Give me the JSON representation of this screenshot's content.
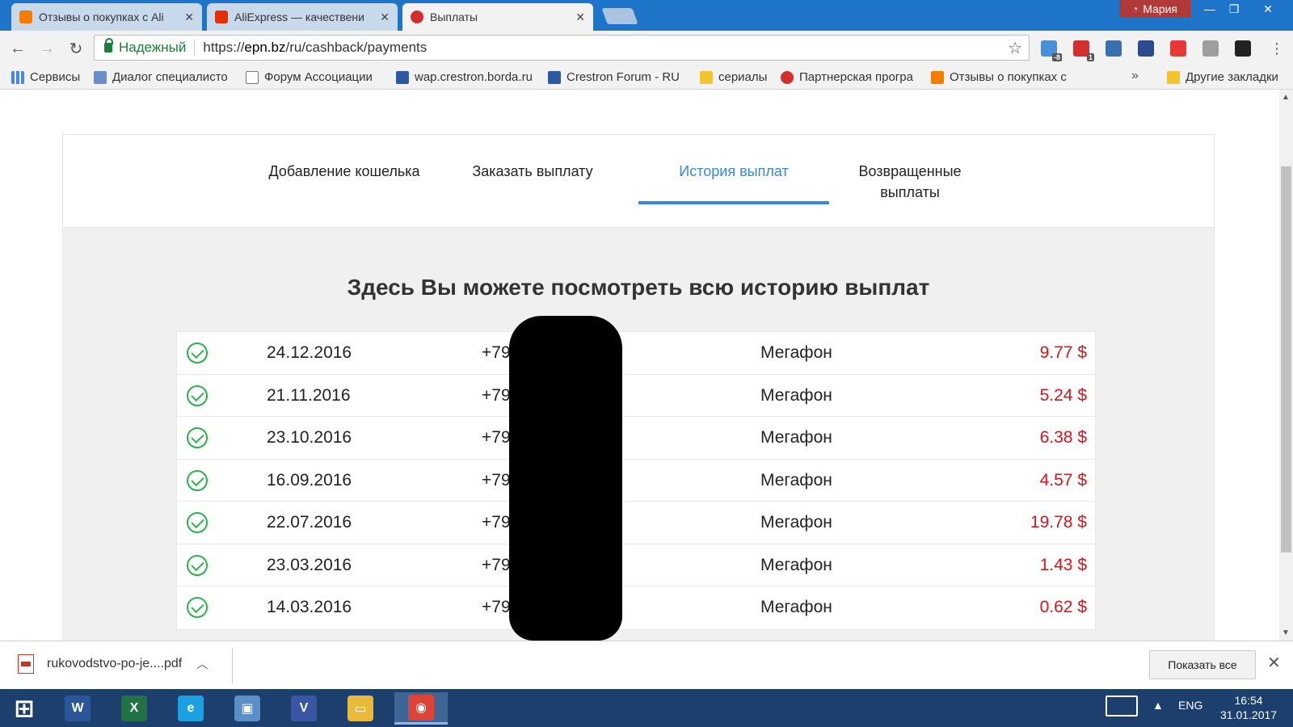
{
  "browser": {
    "tabs": [
      {
        "title": "Отзывы о покупках с Ali",
        "favicon_color": "#f57c00"
      },
      {
        "title": "AliExpress — качествени",
        "favicon_color": "#e62e04"
      },
      {
        "title": "Выплаты",
        "favicon_color": "#d32f2f"
      }
    ],
    "close_glyph": "✕",
    "profile_name": "Мария",
    "window_controls": {
      "minimize": "—",
      "restore": "❐",
      "close": "✕"
    },
    "address": {
      "secure_label": "Надежный",
      "scheme": "https://",
      "host": "epn.bz",
      "path": "/ru/cashback/payments"
    },
    "extensions": [
      {
        "name": "weather-icon",
        "badge": "-8",
        "color": "#4a90d9"
      },
      {
        "name": "adblock-icon",
        "badge": "1",
        "color": "#d32f2f"
      },
      {
        "name": "download-icon",
        "badge": "",
        "color": "#3a6fb0"
      },
      {
        "name": "chart-icon",
        "badge": "",
        "color": "#2c4b8f"
      },
      {
        "name": "epn-icon",
        "badge": "",
        "color": "#e53935"
      },
      {
        "name": "cloud-icon",
        "badge": "",
        "color": "#9e9e9e"
      },
      {
        "name": "panel-icon",
        "badge": "",
        "color": "#222222"
      }
    ],
    "bookmarks": [
      {
        "label": "Сервисы",
        "color": "#4285f4"
      },
      {
        "label": "Диалог специалисто",
        "color": "#6a8fc8"
      },
      {
        "label": "Форум Ассоциации",
        "color": "#777777"
      },
      {
        "label": "wap.crestron.borda.ru",
        "color": "#2c5aa0"
      },
      {
        "label": "Crestron Forum - RU",
        "color": "#2c5aa0"
      },
      {
        "label": "сериалы",
        "color": "#f4c430"
      },
      {
        "label": "Партнерская програ",
        "color": "#d32f2f"
      },
      {
        "label": "Отзывы о покупках с",
        "color": "#f57c00"
      }
    ],
    "bookmarks_more": "»",
    "other_bookmarks": "Другие закладки"
  },
  "page": {
    "tabs": [
      {
        "label": "Добавление кошелька"
      },
      {
        "label": "Заказать выплату"
      },
      {
        "label": "История выплат"
      },
      {
        "label": "Возвращенные выплаты"
      }
    ],
    "heading": "Здесь Вы можете посмотреть всю историю выплат",
    "payments": [
      {
        "date": "24.12.2016",
        "phone": "+79",
        "operator": "Мегафон",
        "amount": "9.77 $"
      },
      {
        "date": "21.11.2016",
        "phone": "+79",
        "operator": "Мегафон",
        "amount": "5.24 $"
      },
      {
        "date": "23.10.2016",
        "phone": "+79",
        "operator": "Мегафон",
        "amount": "6.38 $"
      },
      {
        "date": "16.09.2016",
        "phone": "+792",
        "operator": "Мегафон",
        "amount": "4.57 $"
      },
      {
        "date": "22.07.2016",
        "phone": "+792",
        "operator": "Мегафон",
        "amount": "19.78 $"
      },
      {
        "date": "23.03.2016",
        "phone": "+792",
        "operator": "Мегафон",
        "amount": "1.43 $"
      },
      {
        "date": "14.03.2016",
        "phone": "+792",
        "operator": "Мегафон",
        "amount": "0.62 $"
      }
    ]
  },
  "downloads": {
    "file": "rukovodstvo-po-je....pdf",
    "show_all": "Показать все",
    "close_glyph": "✕"
  },
  "taskbar": {
    "apps": [
      {
        "name": "start-icon",
        "glyph": "⊞",
        "color": "#1c3f6e"
      },
      {
        "name": "word-icon",
        "glyph": "W",
        "color": "#2b579a"
      },
      {
        "name": "excel-icon",
        "glyph": "X",
        "color": "#217346"
      },
      {
        "name": "ie-icon",
        "glyph": "e",
        "color": "#1ba1e2"
      },
      {
        "name": "control-panel-icon",
        "glyph": "▣",
        "color": "#5a8fc7"
      },
      {
        "name": "visio-icon",
        "glyph": "V",
        "color": "#3955a3"
      },
      {
        "name": "explorer-icon",
        "glyph": "▭",
        "color": "#e8b93a"
      },
      {
        "name": "chrome-icon",
        "glyph": "◉",
        "color": "#db4437"
      }
    ],
    "language": "ENG",
    "time": "16:54",
    "date": "31.01.2017"
  },
  "colors": {
    "accent": "#3a86d9",
    "amount": "#d9141c",
    "success": "#2bb24c"
  }
}
